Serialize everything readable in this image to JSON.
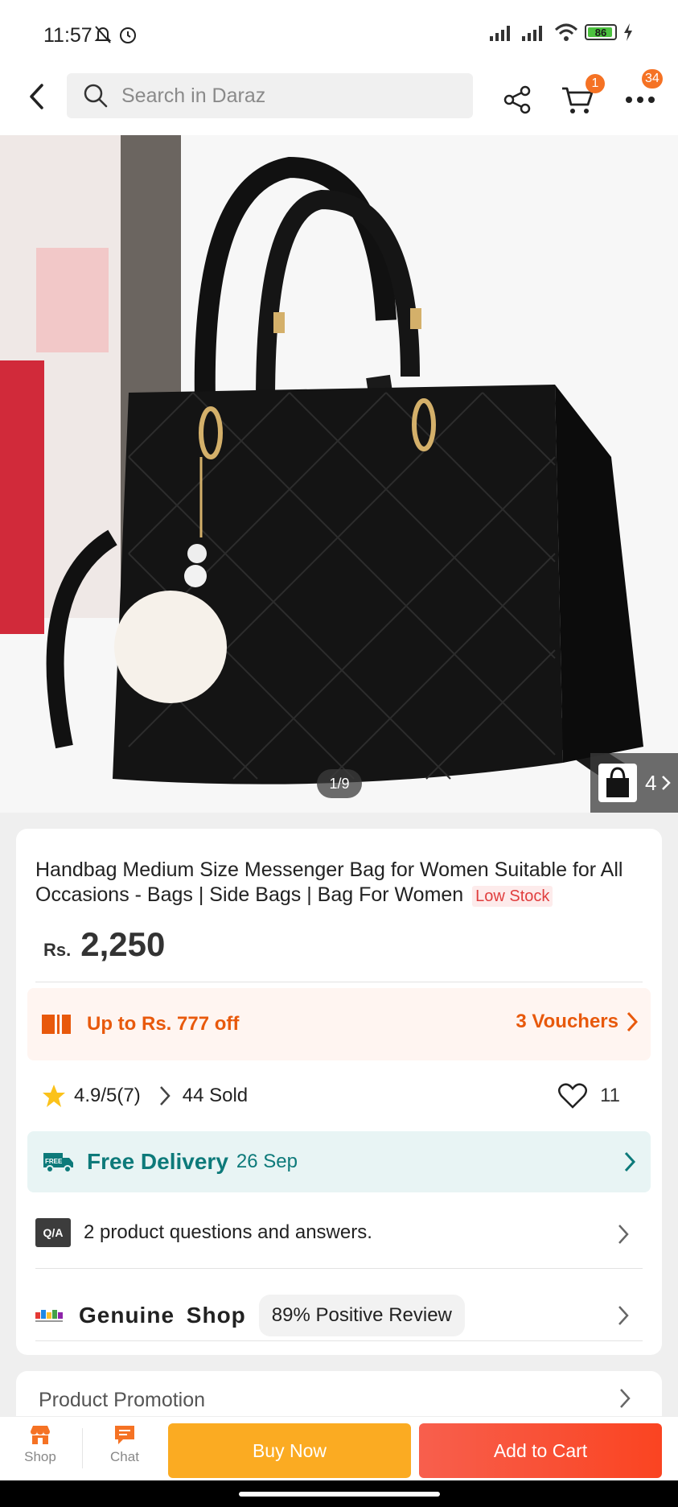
{
  "status_bar": {
    "time": "11:57",
    "battery_level": "86"
  },
  "header": {
    "search_placeholder": "Search in Daraz",
    "cart_badge": "1",
    "more_badge": "34"
  },
  "gallery": {
    "counter": "1/9",
    "thumb_count": "4"
  },
  "product": {
    "title": "Handbag Medium Size Messenger Bag for Women Suitable for All Occasions - Bags | Side Bags | Bag For Women",
    "stock_badge": "Low Stock",
    "currency": "Rs.",
    "price": "2,250"
  },
  "voucher": {
    "text": "Up to Rs. 777 off",
    "link": "3 Vouchers"
  },
  "rating": {
    "value": "4.9/5",
    "count": "(7)",
    "sold": "44 Sold",
    "favorites": "11"
  },
  "delivery": {
    "label": "Free Delivery",
    "date": "26 Sep",
    "icon_text": "FREE"
  },
  "qa": {
    "icon_text": "Q/A",
    "text": "2 product questions and answers."
  },
  "shop": {
    "name": "Genuine  Shop",
    "review": "89% Positive Review"
  },
  "promotion": {
    "label": "Product Promotion"
  },
  "bottom_bar": {
    "shop_label": "Shop",
    "chat_label": "Chat",
    "buy_now": "Buy Now",
    "add_to_cart": "Add to Cart"
  },
  "colors": {
    "accent_orange": "#f57224",
    "buy_now": "#fbab22",
    "add_to_cart": "#fa4421",
    "delivery_teal": "#0d7a7a",
    "voucher_orange": "#e8590c"
  }
}
